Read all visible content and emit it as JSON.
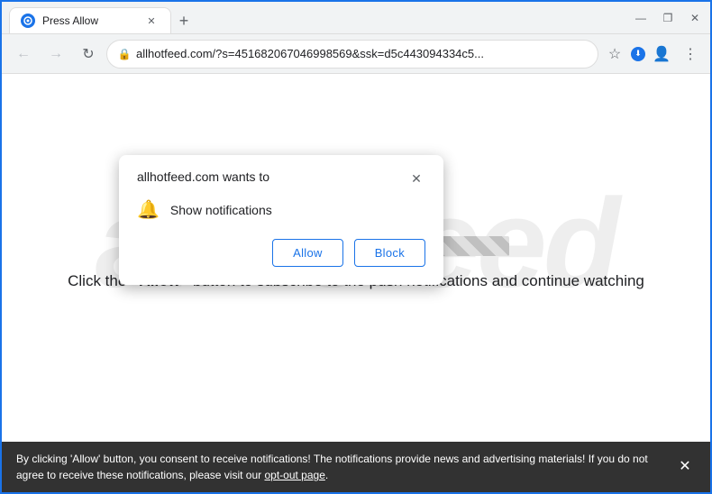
{
  "browser": {
    "title_bar": {
      "tab_label": "Press Allow",
      "new_tab_label": "+",
      "minimize": "—",
      "maximize": "❐",
      "close": "✕"
    },
    "nav_bar": {
      "back": "←",
      "forward": "→",
      "reload": "↻",
      "address": "allhotfeed.com/?s=451682067046998569&ssk=d5c443094334c5...",
      "lock_symbol": "🔒",
      "star_symbol": "☆",
      "account_symbol": "👤",
      "menu_symbol": "⋮",
      "download_symbol": "⬇"
    }
  },
  "notification_popup": {
    "title": "allhotfeed.com wants to",
    "close_symbol": "✕",
    "notification_label": "Show notifications",
    "bell_symbol": "🔔",
    "allow_label": "Allow",
    "block_label": "Block"
  },
  "page": {
    "watermark_text": "allhofeed",
    "instruction_html": "Click the «Allow» button to subscribe to the push notifications and continue watching"
  },
  "bottom_bar": {
    "message": "By clicking 'Allow' button, you consent to receive notifications! The notifications provide news and advertising materials! If you do not agree to receive these notifications, please visit our ",
    "link_text": "opt-out page",
    "close_symbol": "✕"
  }
}
